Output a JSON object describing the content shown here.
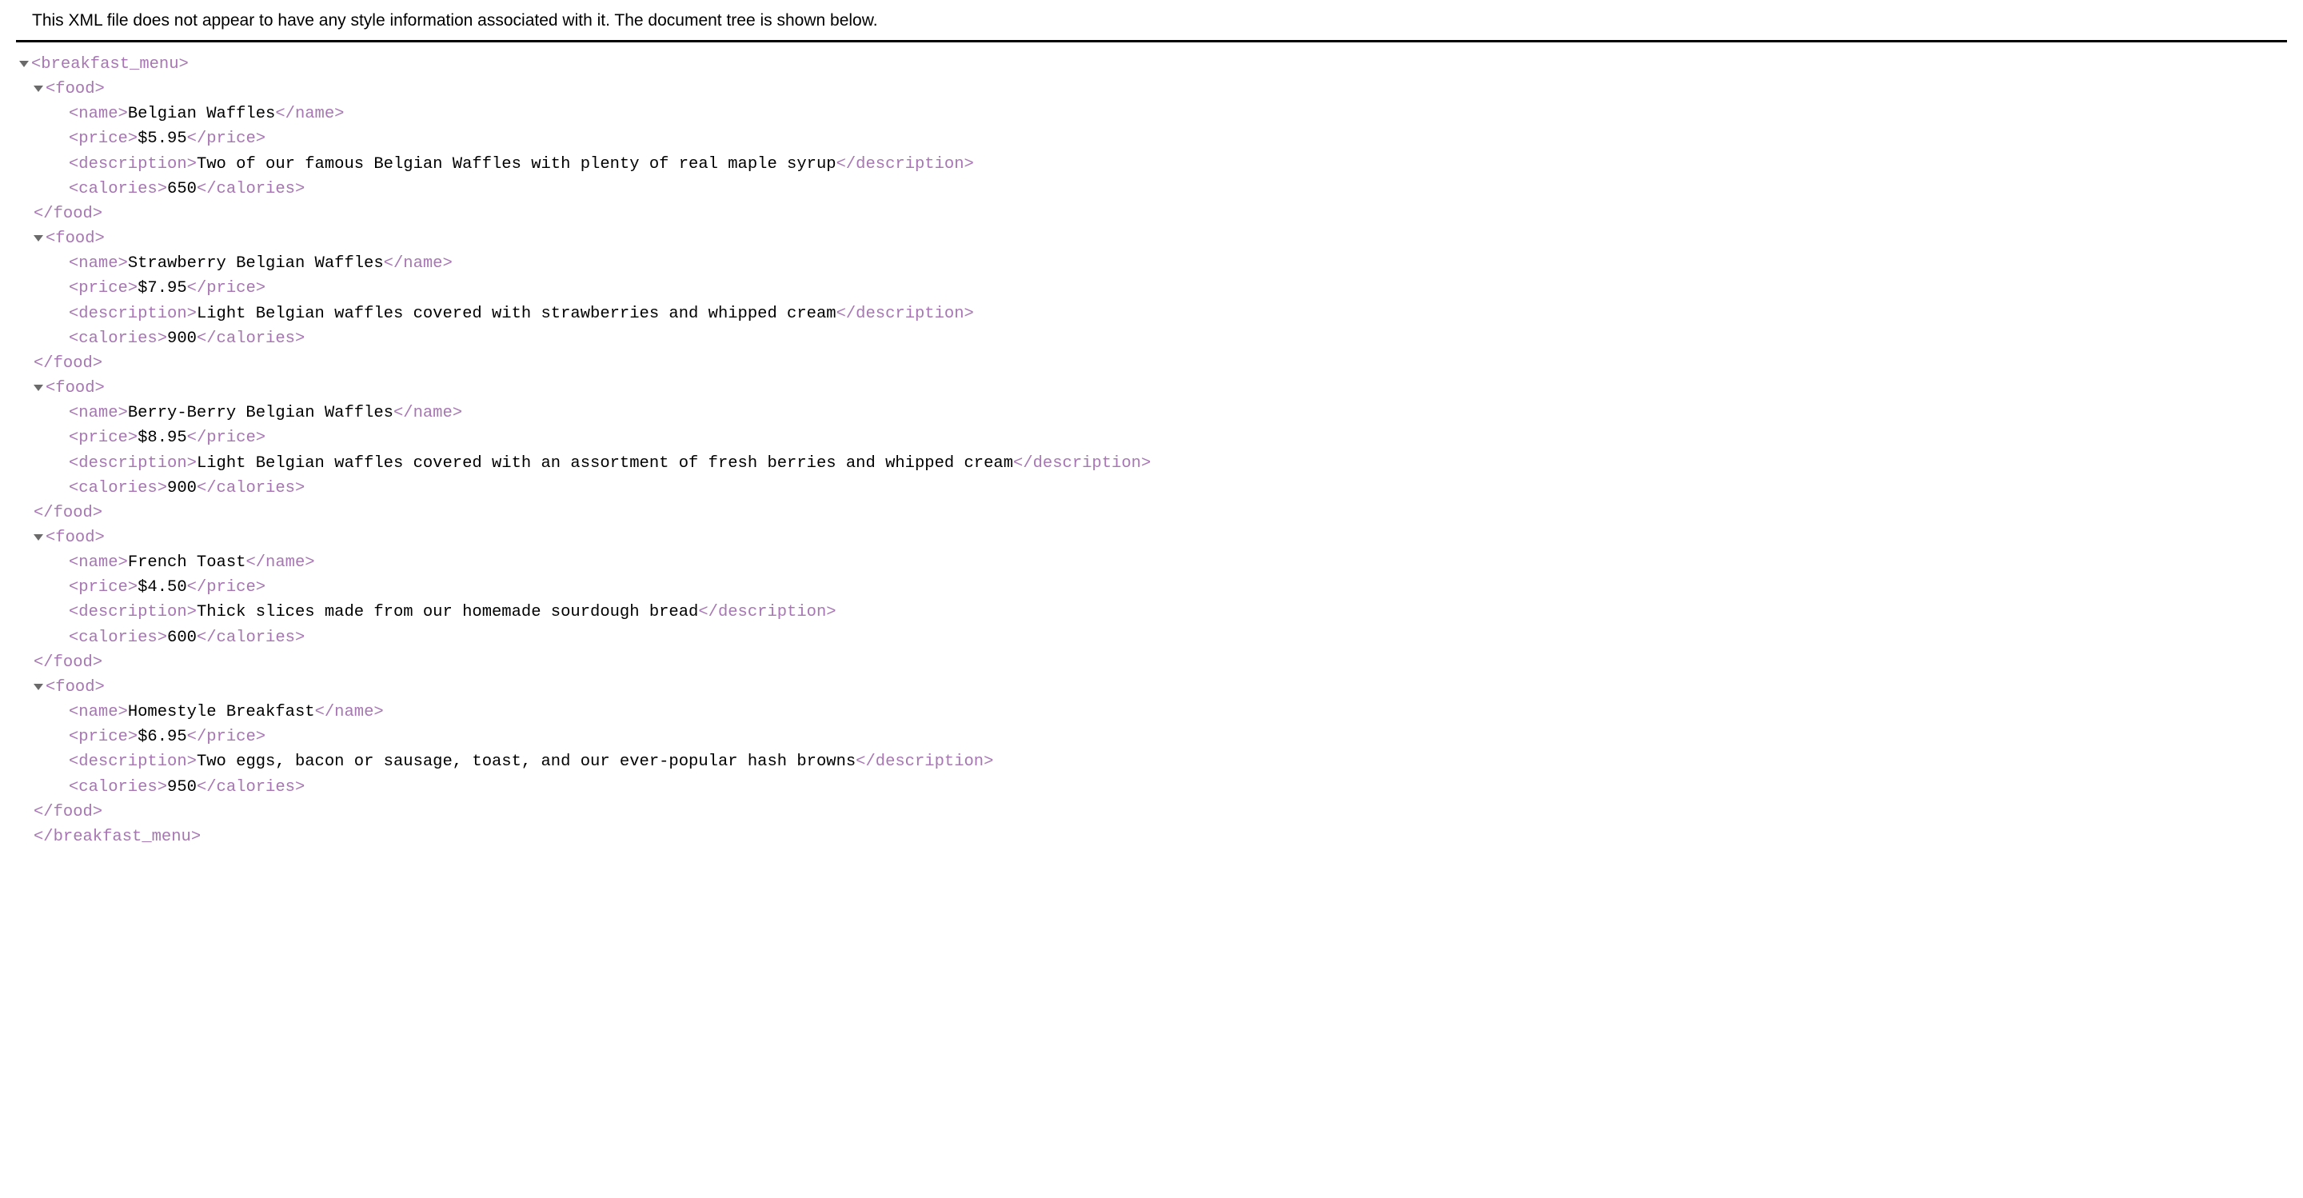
{
  "header": {
    "message": "This XML file does not appear to have any style information associated with it. The document tree is shown below."
  },
  "root_tag": "breakfast_menu",
  "item_tag": "food",
  "field_tags": {
    "name": "name",
    "price": "price",
    "description": "description",
    "calories": "calories"
  },
  "foods": [
    {
      "name": "Belgian Waffles",
      "price": "$5.95",
      "description": "Two of our famous Belgian Waffles with plenty of real maple syrup",
      "calories": "650"
    },
    {
      "name": "Strawberry Belgian Waffles",
      "price": "$7.95",
      "description": "Light Belgian waffles covered with strawberries and whipped cream",
      "calories": "900"
    },
    {
      "name": "Berry-Berry Belgian Waffles",
      "price": "$8.95",
      "description": "Light Belgian waffles covered with an assortment of fresh berries and whipped cream",
      "calories": "900"
    },
    {
      "name": "French Toast",
      "price": "$4.50",
      "description": "Thick slices made from our homemade sourdough bread",
      "calories": "600"
    },
    {
      "name": "Homestyle Breakfast",
      "price": "$6.95",
      "description": "Two eggs, bacon or sausage, toast, and our ever-popular hash browns",
      "calories": "950"
    }
  ]
}
